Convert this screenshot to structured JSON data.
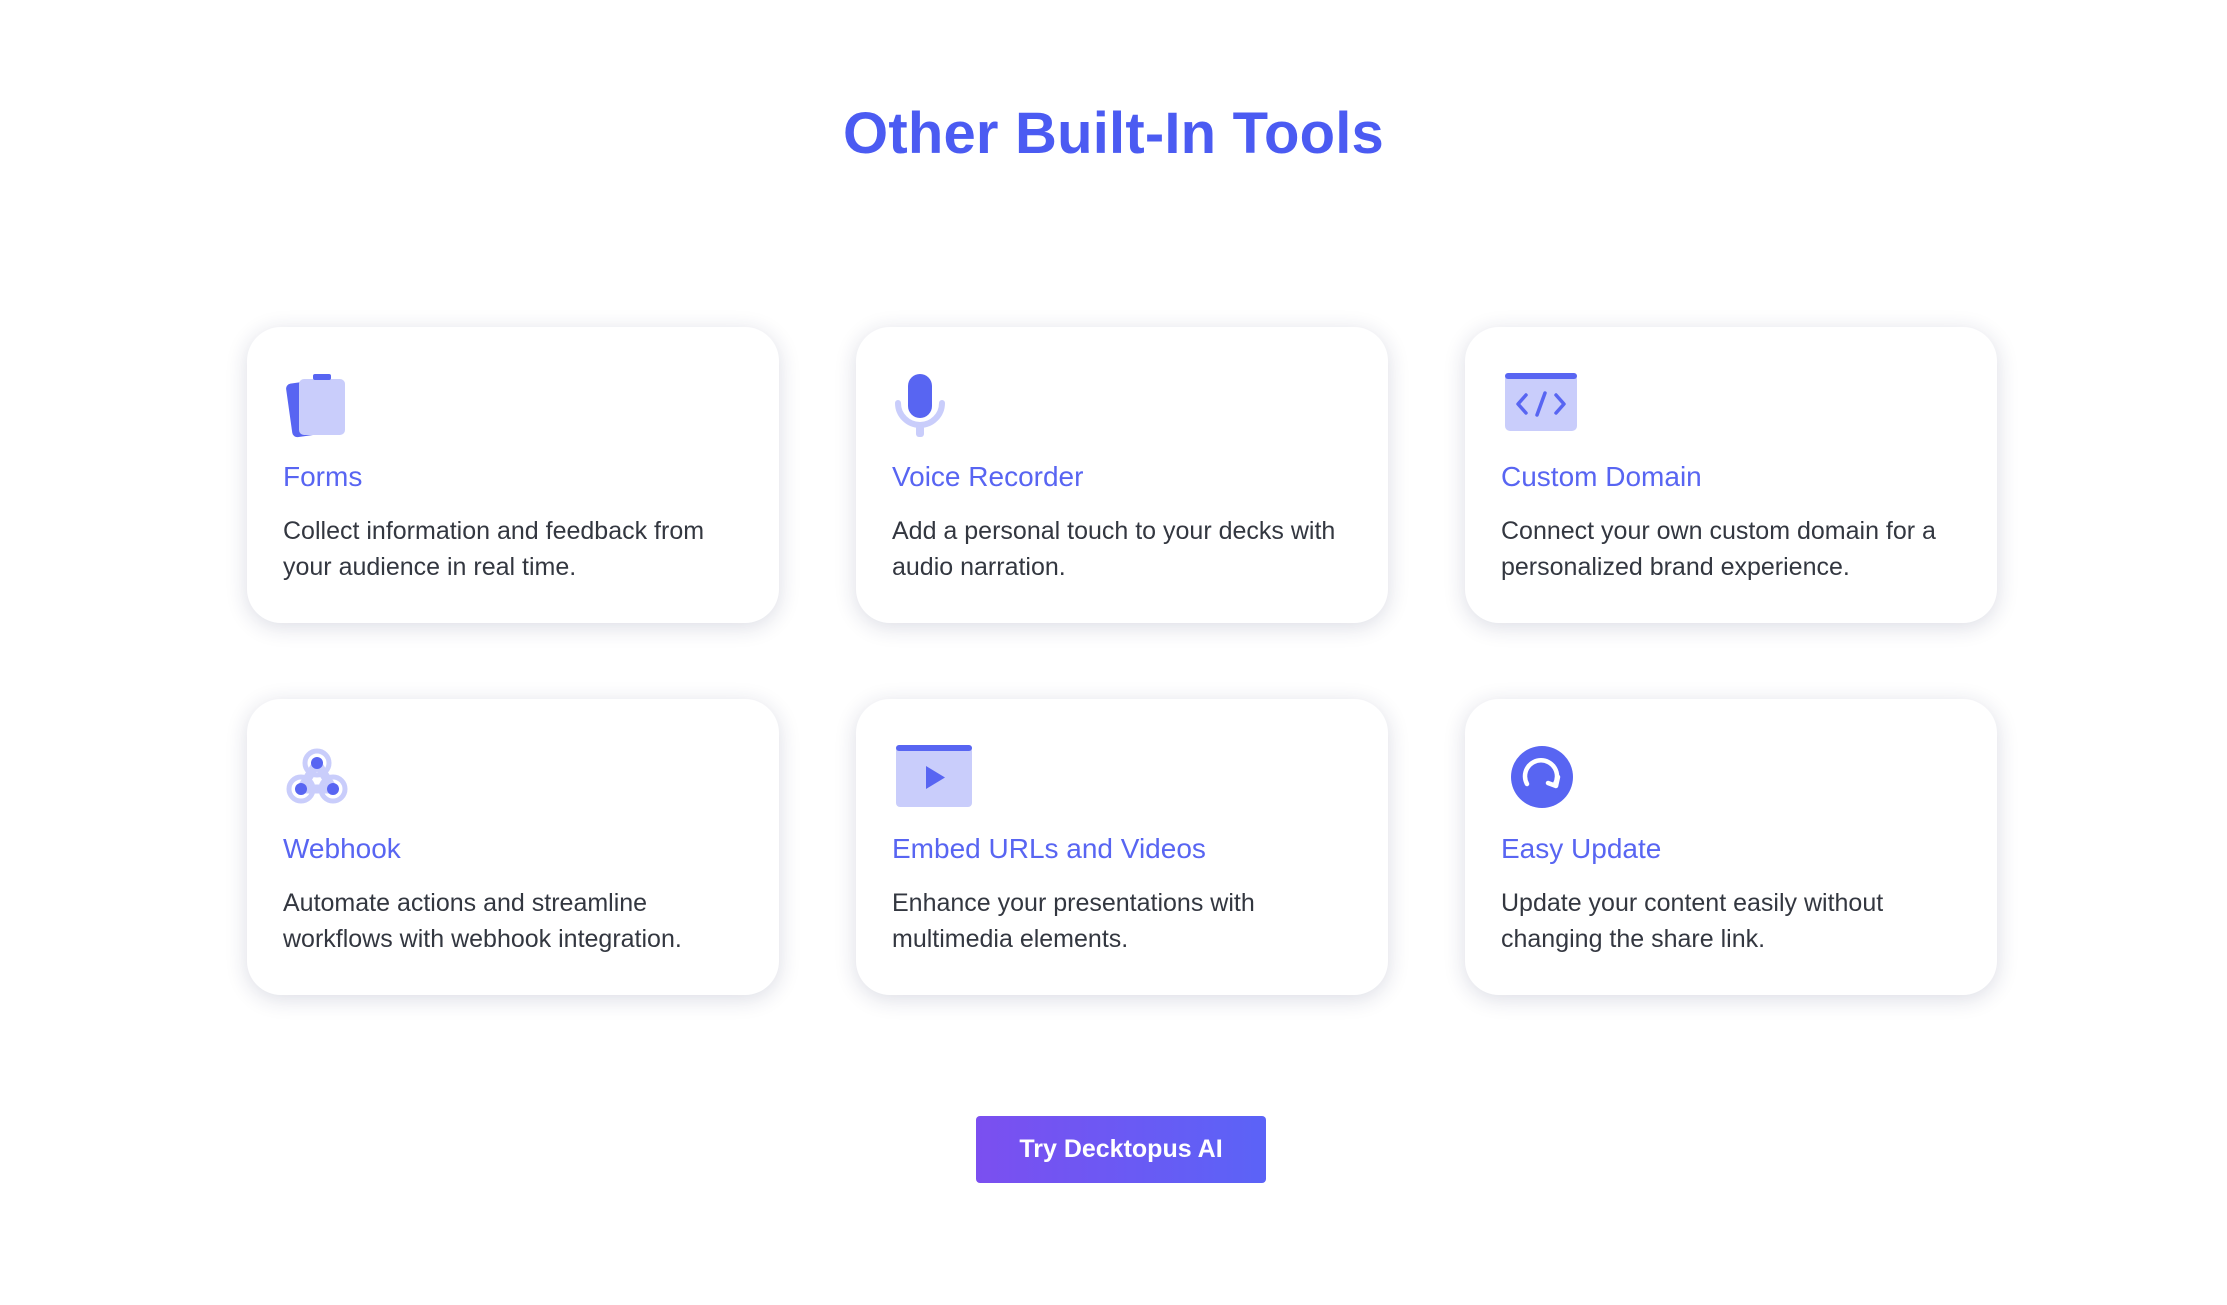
{
  "page": {
    "title": "Other Built-In Tools"
  },
  "theme": {
    "accent": "#4B5BF2",
    "card_title": "#5865F2",
    "text": "#333740",
    "icon_light": "#C9CDFB",
    "icon_dark": "#5865F2",
    "button_gradient": [
      "#7B4FF0",
      "#5B63F7"
    ]
  },
  "cards": [
    {
      "icon": "forms-clipboard-icon",
      "title": "Forms",
      "description": "Collect information and feedback from your audience in real time."
    },
    {
      "icon": "microphone-icon",
      "title": "Voice Recorder",
      "description": "Add a personal touch to your decks with audio narration."
    },
    {
      "icon": "code-window-icon",
      "title": "Custom Domain",
      "description": "Connect your own custom domain for a personalized brand experience."
    },
    {
      "icon": "webhook-icon",
      "title": "Webhook",
      "description": "Automate actions and streamline workflows with webhook integration."
    },
    {
      "icon": "video-play-icon",
      "title": "Embed URLs and Videos",
      "description": "Enhance your presentations with multimedia elements."
    },
    {
      "icon": "refresh-circle-icon",
      "title": "Easy Update",
      "description": "Update your content easily without changing the share link."
    }
  ],
  "cta": {
    "label": "Try Decktopus AI"
  }
}
